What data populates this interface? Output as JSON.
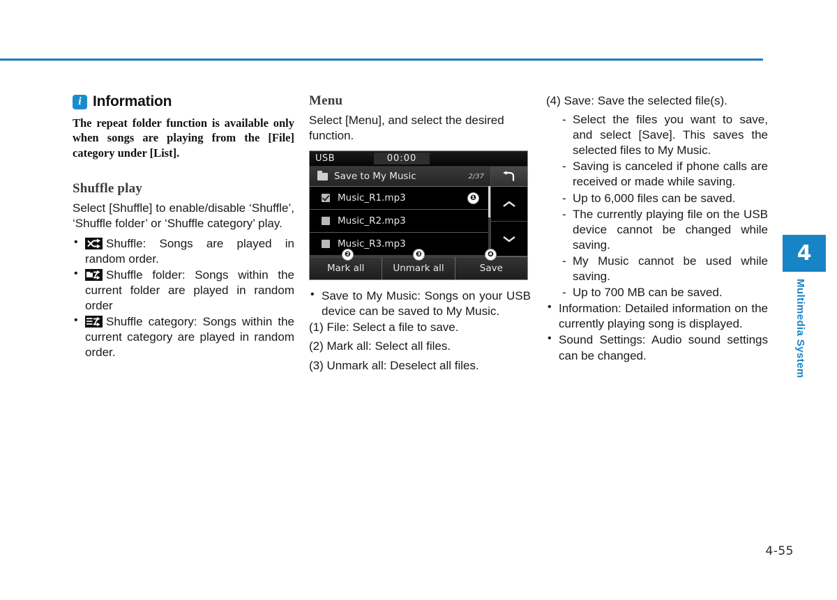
{
  "page": {
    "number": "4-55",
    "chapter_tab_number": "4",
    "chapter_label": "Multimedia System",
    "accent_color": "#1784c6",
    "rule_color": "#1a7cb8"
  },
  "left_column": {
    "information": {
      "icon": "info-icon",
      "title": "Information",
      "body": "The repeat folder function is available only when songs are playing from the [File] category under [List]."
    },
    "shuffle_play": {
      "heading": "Shuffle play",
      "intro": "Select [Shuffle] to enable/disable ‘Shuffle’, ‘Shuffle folder’ or ‘Shuffle category’ play.",
      "items": [
        {
          "icon": "shuffle-icon",
          "text": "Shuffle: Songs are played in random order."
        },
        {
          "icon": "shuffle-folder-icon",
          "text": "Shuffle folder: Songs within the current folder are played in random order"
        },
        {
          "icon": "shuffle-category-icon",
          "text": "Shuffle category: Songs within the current category are played in random order."
        }
      ]
    }
  },
  "middle_column": {
    "menu": {
      "heading": "Menu",
      "intro": "Select [Menu], and select the desired function."
    },
    "device_screen": {
      "status_bar": {
        "source": "USB",
        "clock": "00:00"
      },
      "title_row": {
        "icon": "folder-icon",
        "title": "Save to My Music",
        "count": "2/37"
      },
      "rows": [
        {
          "checked": true,
          "name": "Music_R1.mp3",
          "callout": "❶"
        },
        {
          "checked": false,
          "name": "Music_R2.mp3"
        },
        {
          "checked": false,
          "name": "Music_R3.mp3"
        }
      ],
      "side_buttons": [
        {
          "icon": "back-arrow-icon",
          "name": "back"
        },
        {
          "icon": "chevron-up-icon",
          "name": "scroll-up"
        },
        {
          "icon": "chevron-down-icon",
          "name": "scroll-down"
        }
      ],
      "footer_buttons": [
        {
          "label": "Mark all",
          "callout": "❷"
        },
        {
          "label": "Unmark all",
          "callout": "❸"
        },
        {
          "label": "Save",
          "callout": "❹"
        }
      ]
    },
    "bullets": [
      "Save to My Music: Songs on your USB device can be saved to My Music."
    ],
    "numbered": [
      "(1) File: Select a file to save.",
      "(2) Mark all: Select all files.",
      "(3) Unmark all: Deselect all files."
    ]
  },
  "right_column": {
    "save_item": "(4) Save: Save the selected file(s).",
    "save_sub_items": [
      "Select the files you want to save, and select [Save]. This saves the selected files to My Music.",
      "Saving is canceled if phone calls are received or made while saving.",
      "Up to 6,000 files can be saved.",
      "The currently playing file on the USB device cannot be changed while saving.",
      "My Music cannot be used while saving.",
      "Up to 700 MB can be saved."
    ],
    "bullets": [
      "Information: Detailed information on the currently playing song is displayed.",
      "Sound Settings: Audio sound settings can be changed."
    ]
  }
}
